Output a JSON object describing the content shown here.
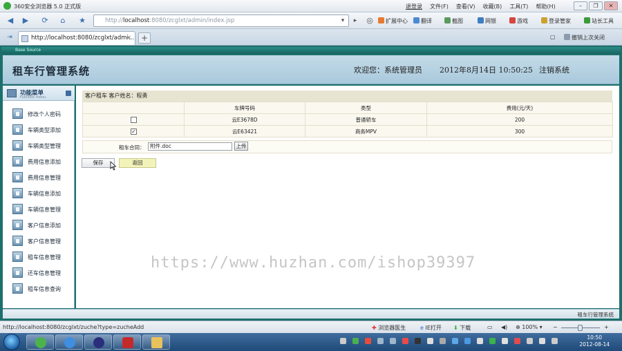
{
  "browser": {
    "title": "360安全浏览器 5.0 正式版",
    "menu": [
      "退登录",
      "文件(F)",
      "查看(V)",
      "收藏(B)",
      "工具(T)",
      "帮助(H)"
    ],
    "address_prefix": "http://",
    "address_host": "localhost",
    "address_rest": ":8080/zcglxt/admin/index.jsp",
    "tools": [
      "扩展中心",
      "翻译",
      "截图",
      "网银",
      "游戏",
      "登录管家",
      "站长工具"
    ],
    "tab_label": "http://localhost:8080/zcglxt/admi...",
    "restore_tab_label": "撤销上次关闭"
  },
  "app": {
    "strip_text": "Base Source",
    "title": "租车行管理系统",
    "welcome": "欢迎您：系统管理员",
    "datetime": "2012年8月14日 10:50:25",
    "logout": "注销系统",
    "footer": "租车行管理系统"
  },
  "sidebar": {
    "title": "功能菜单",
    "subtitle": "Function menu",
    "items": [
      "修改个人密码",
      "车辆类型添加",
      "车辆类型管理",
      "费用信息添加",
      "费用信息管理",
      "车辆信息添加",
      "车辆信息管理",
      "客户信息添加",
      "客户信息管理",
      "租车信息管理",
      "还车信息管理",
      "租车信息查询"
    ]
  },
  "content": {
    "breadcrumb": "客户租车  客户姓名：程勇",
    "columns": [
      "",
      "车牌号码",
      "类型",
      "费用(元/天)"
    ],
    "rows": [
      {
        "checked": false,
        "plate": "云E3678D",
        "type": "普通轿车",
        "fee": "200"
      },
      {
        "checked": true,
        "plate": "云E63421",
        "type": "商务MPV",
        "fee": "300"
      }
    ],
    "contract_label": "租车合同：",
    "contract_file": "附件.doc",
    "upload_label": "上传",
    "save_label": "保存",
    "back_label": "返回",
    "watermark": "https://www.huzhan.com/ishop39397"
  },
  "status": {
    "url": "http://localhost:8080/zcglxt/zuche?type=zucheAdd",
    "items": [
      "浏览器医生",
      "IE打开",
      "下载",
      "100%"
    ]
  },
  "taskbar": {
    "time": "10:50",
    "date": "2012-08-14"
  },
  "colors": {
    "app_frame": "#1d6f6c",
    "header_bg": "#b8d2e2",
    "back_button": "#f2f3b8",
    "table_bg": "#faf8ef",
    "breadcrumb_bg": "#e8e4d2"
  }
}
